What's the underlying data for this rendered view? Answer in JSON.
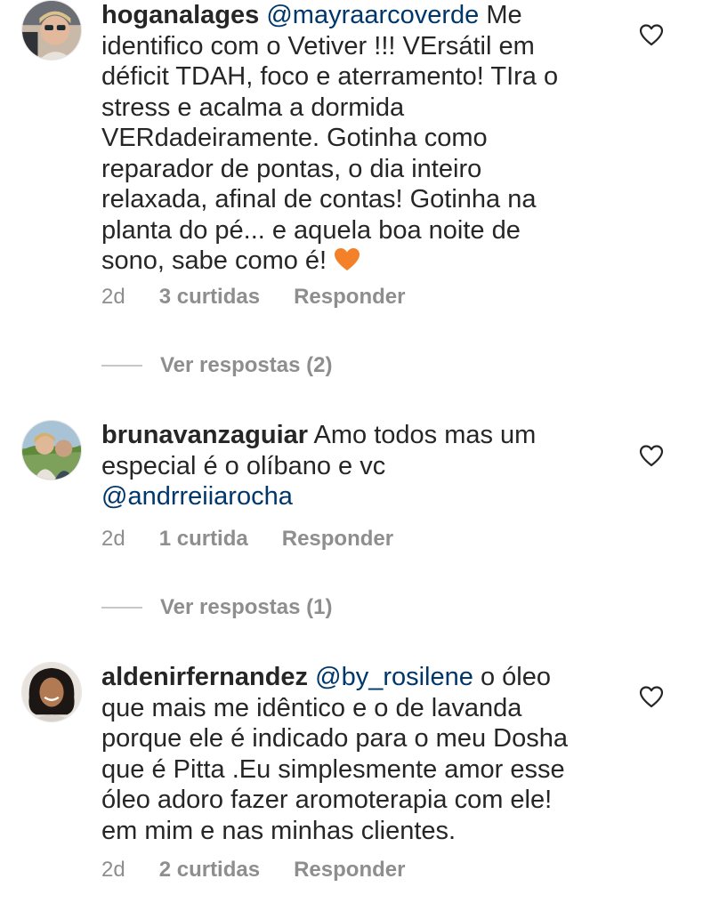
{
  "comments": [
    {
      "username": "hoganalages",
      "mention": "@mayraarcoverde",
      "lines": [
        " Me",
        "identifico com o Vetiver !!! VErsátil em",
        "déficit TDAH, foco e aterramento! TIra o",
        "stress e acalma a dormida",
        "VERdadeiramente. Gotinha como",
        "reparador de pontas, o dia inteiro",
        "relaxada, afinal de contas! Gotinha na",
        "planta do pé... e aquela boa noite de",
        "sono, sabe como é! "
      ],
      "emoji": "orange-heart",
      "time": "2d",
      "likes": "3 curtidas",
      "reply": "Responder",
      "view_replies": "Ver respostas (2)"
    },
    {
      "username": "brunavanzaguiar",
      "text_main": " Amo todos mas um",
      "text_line2": "especial é o olíbano e vc",
      "mention": "@andrreiiarocha",
      "time": "2d",
      "likes": "1 curtida",
      "reply": "Responder",
      "view_replies": "Ver respostas (1)"
    },
    {
      "username": "aldenirfernandez",
      "mention": "@by_rosilene",
      "lines": [
        " o óleo",
        "que mais me idêntico e o de lavanda",
        "porque ele é indicado para o meu Dosha",
        "que é Pitta .Eu simplesmente amor esse",
        "óleo adoro fazer aromoterapia com ele!",
        "em mim e nas minhas clientes."
      ],
      "time": "2d",
      "likes": "2 curtidas",
      "reply": "Responder"
    }
  ],
  "colors": {
    "text": "#262626",
    "secondary": "#8e8e8e",
    "mention": "#00376b",
    "emoji_heart": "#f4802a"
  },
  "icons": {
    "like": "heart-outline-icon"
  }
}
